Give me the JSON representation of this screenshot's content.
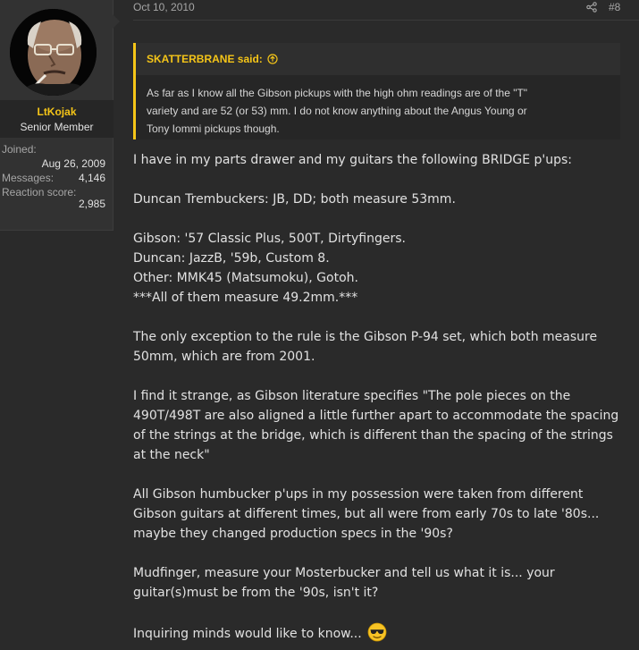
{
  "post": {
    "date": "Oct 10, 2010",
    "number": "#8",
    "share_icon": "share-icon"
  },
  "user": {
    "avatar_icon": "avatar",
    "name": "LtKojak",
    "title": "Senior Member",
    "stats": {
      "joined_label": "Joined:",
      "joined_value": "Aug 26, 2009",
      "messages_label": "Messages:",
      "messages_value": "4,146",
      "reaction_label": "Reaction score:",
      "reaction_value": "2,985"
    }
  },
  "quote": {
    "author": "SKATTERBRANE said:",
    "lines": [
      "As far as I know all the Gibson pickups with the high ohm readings are of the \"T\"",
      "variety and are 52 (or 53) mm. I do not know anything about the Angus Young or",
      "Tony Iommi pickups though."
    ]
  },
  "message": {
    "p1": "I have in my parts drawer and my guitars the following BRIDGE p'ups:",
    "p2": "Duncan Trembuckers: JB, DD; both measure 53mm.",
    "p3": [
      "Gibson: '57 Classic Plus, 500T, Dirtyfingers.",
      "Duncan: JazzB, '59b, Custom 8.",
      "Other: MMK45 (Matsumoku), Gotoh.",
      "***All of them measure 49.2mm.***"
    ],
    "p4": [
      "The only exception to the rule is the Gibson P-94 set, which both measure",
      "50mm, which are from 2001."
    ],
    "p5": [
      "I find it strange, as Gibson literature specifies \"The pole pieces on the",
      "490T/498T are also aligned a little further apart to accommodate the spacing",
      "of the strings at the bridge, which is different than the spacing of the strings",
      "at the neck\""
    ],
    "p6": [
      "All Gibson humbucker p'ups in my possession were taken from different",
      "Gibson guitars at different times, but all were from early 70s to late '80s...",
      "maybe they changed production specs in the '90s?"
    ],
    "p7": [
      "Mudfinger, measure your Mosterbucker and tell us what it is... your",
      "guitar(s)must be from the '90s, isn't it?"
    ],
    "p8": "Inquiring minds would like to know...",
    "emoji": "sunglasses-emoji"
  }
}
